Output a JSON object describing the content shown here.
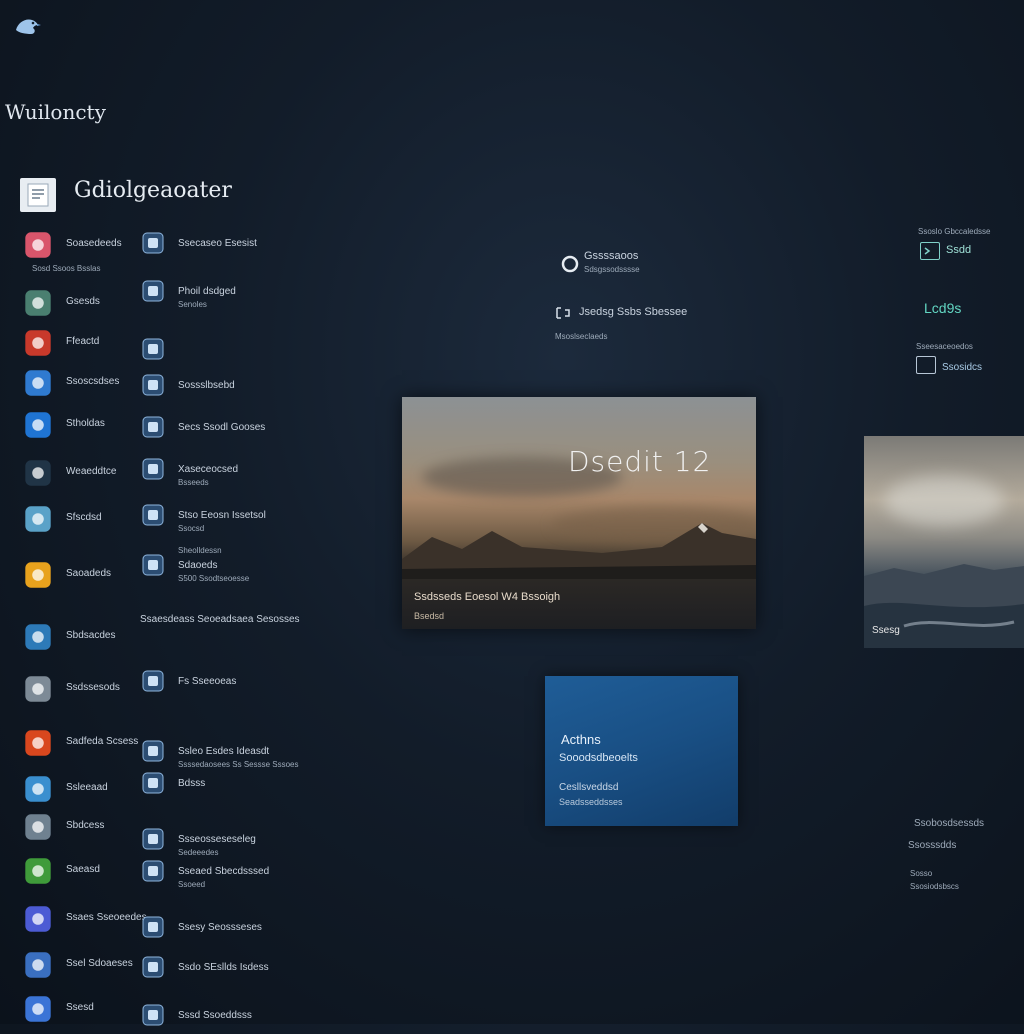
{
  "app": {
    "logo_icon": "bird-logo-icon",
    "title": "Wuiloncty",
    "section_title": "Gdiolgeaoater"
  },
  "left_column": [
    {
      "label": "Soasedeeds",
      "sub": "Sosd Ssoos Bsslas",
      "icon": "photo-app-icon",
      "color": "#d9556b"
    },
    {
      "label": "Gsesds",
      "icon": "folder-app-icon",
      "color": "#4a7f70"
    },
    {
      "label": "Ffeactd",
      "icon": "game-app-icon",
      "color": "#c8392b"
    },
    {
      "label": "Ssoscsdses",
      "icon": "user-app-icon",
      "color": "#2f7ad0"
    },
    {
      "label": "Stholdas",
      "icon": "store-app-icon",
      "color": "#1f74d3"
    },
    {
      "label": "Weaeddtce",
      "icon": "chat-app-icon",
      "color": "#203446"
    },
    {
      "label": "Sfscdsd",
      "icon": "document-app-icon",
      "color": "#5aa2c8"
    },
    {
      "label": "Saoadeds",
      "icon": "toolbox-app-icon",
      "color": "#e8a21d"
    },
    {
      "label": "Sbdsacdes",
      "icon": "shield-app-icon",
      "color": "#2d7ab8"
    },
    {
      "label": "Ssdssesods",
      "icon": "shape-app-icon",
      "color": "#7d8a96"
    },
    {
      "label": "Sadfeda Scsess",
      "icon": "office-app-icon",
      "color": "#d9471e"
    },
    {
      "label": "Ssleeaad",
      "icon": "cloud-app-icon",
      "color": "#3a8fcf"
    },
    {
      "label": "Sbdcess",
      "icon": "settings-app-icon",
      "color": "#6f8190"
    },
    {
      "label": "Saeasd",
      "icon": "xbox-app-icon",
      "color": "#3f9b3a"
    },
    {
      "label": "Ssaes Sseoeedes",
      "icon": "teams-app-icon",
      "color": "#4c5bd4"
    },
    {
      "label": "Ssel Sdoaeses",
      "icon": "puzzle-app-icon",
      "color": "#3a6fc0"
    },
    {
      "label": "Ssesd",
      "icon": "circle-app-icon",
      "color": "#3b74d6"
    }
  ],
  "mid_column": [
    {
      "label": "Ssecaseo Esesist",
      "icon": "photos-icon"
    },
    {
      "label": "Phoil dsdged",
      "sub": "Senoles",
      "icon": "camera-icon"
    },
    {
      "label": "",
      "icon": "globe-icon"
    },
    {
      "label": "Sossslbsebd",
      "icon": "mail-icon"
    },
    {
      "label": "Secs Ssodl Gooses",
      "icon": "windows-icon"
    },
    {
      "label": "Xaseceocsed",
      "sub": "Bsseeds",
      "icon": "window-icon"
    },
    {
      "label": "Stso Eeosn Issetsol",
      "sub": "Ssocsd",
      "icon": "box-icon"
    },
    {
      "label": "Sdaoeds",
      "sub": "S500 Ssodtseoesse",
      "sub2": "Sheolldessn",
      "icon": "notes-icon"
    },
    {
      "label": "Ssaesdeass Seoeadsaea Sesosses",
      "icon": "none"
    },
    {
      "label": "Fs Sseeoeas",
      "icon": "folder-icon"
    },
    {
      "label": "Ssleo Esdes Ideasdt",
      "sub": "Ssssedaosees Ss Sessse Sssoes",
      "icon": "people-icon"
    },
    {
      "label": "Bdsss",
      "icon": "calculator-icon"
    },
    {
      "label": "Ssseosseseseleg",
      "sub": "Sedeeedes",
      "icon": "home-icon"
    },
    {
      "label": "Sseaed Sbecdsssed",
      "sub": "Ssoeed",
      "icon": "tool-icon"
    },
    {
      "label": "Ssesy Seossseses",
      "icon": "pen-icon"
    },
    {
      "label": "Ssdo SEsllds Isdess",
      "icon": "pencil-icon"
    },
    {
      "label": "Sssd Ssoeddsss",
      "icon": "link-icon"
    }
  ],
  "center_info": {
    "item1_label": "Gssssaoos",
    "item1_sub": "Sdsgssodsssse",
    "item2_label": "Jsedsg Ssbs Sbessee",
    "item2_sub": "Msoslseclaeds"
  },
  "right_info": {
    "header": "Ssoslo Gbccaledsse",
    "item1": "Ssdd",
    "item2": "Lcd9s",
    "item3_header": "Sseesaceoedos",
    "item3": "Ssosidcs"
  },
  "hero": {
    "title": "Dsedit 12",
    "caption": "Ssdsseds Eoesol W4 Bssoigh",
    "caption2": "Bsedsd"
  },
  "side_image": {
    "caption": "Ssesg"
  },
  "blue_card": {
    "line1": "Acthns",
    "line2": "Sooodsdbeoelts",
    "line3": "Cesllsveddsd",
    "line4": "Seadsseddsses"
  },
  "bottom_right": {
    "line1": "Ssobosdsessds",
    "line2": "Ssosssdds",
    "line3": "Sosso",
    "line4": "Ssosiodsbscs"
  }
}
